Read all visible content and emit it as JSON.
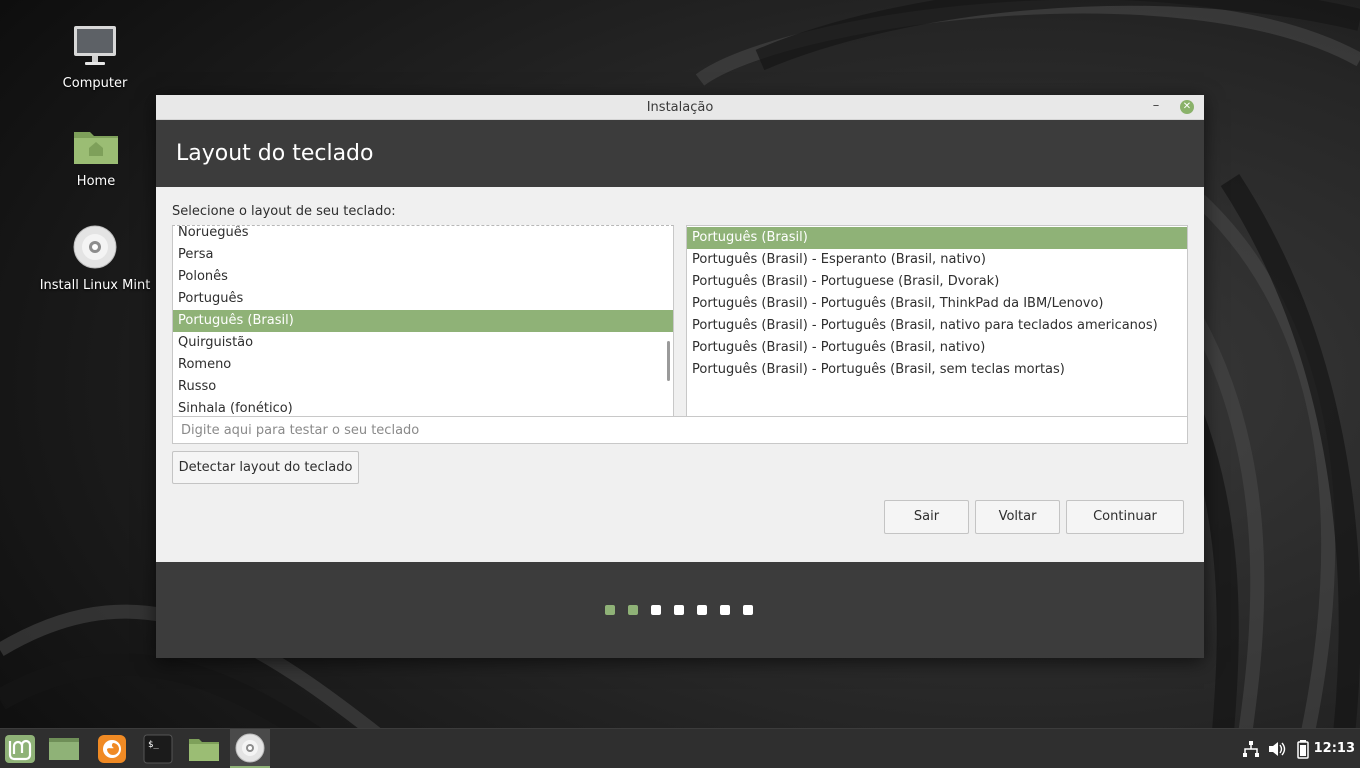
{
  "desktop": {
    "icons": [
      {
        "label": "Computer",
        "icon": "computer-icon"
      },
      {
        "label": "Home",
        "icon": "home-folder-icon"
      },
      {
        "label": "Install Linux Mint",
        "icon": "disc-icon"
      }
    ]
  },
  "window": {
    "title": "Instalação",
    "minimize_label": "–",
    "close_label": "✕",
    "header_title": "Layout do teclado",
    "prompt": "Selecione o layout de seu teclado:",
    "layouts": [
      "Norueguês",
      "Persa",
      "Polonês",
      "Português",
      "Português (Brasil)",
      "Quirguistão",
      "Romeno",
      "Russo",
      "Sinhala (fonético)"
    ],
    "selected_layout": "Português (Brasil)",
    "variants": [
      "Português (Brasil)",
      "Português (Brasil) - Esperanto (Brasil, nativo)",
      "Português (Brasil) - Portuguese (Brasil, Dvorak)",
      "Português (Brasil) - Português (Brasil, ThinkPad da IBM/Lenovo)",
      "Português (Brasil) - Português (Brasil, nativo para teclados americanos)",
      "Português (Brasil) - Português (Brasil, nativo)",
      "Português (Brasil) - Português (Brasil, sem teclas mortas)"
    ],
    "selected_variant": "Português (Brasil)",
    "test_placeholder": "Digite aqui para testar o seu teclado",
    "test_value": "",
    "detect_button": "Detectar layout do teclado",
    "quit_button": "Sair",
    "back_button": "Voltar",
    "continue_button": "Continuar",
    "progress": {
      "total_steps": 7,
      "completed_steps": 2
    }
  },
  "taskbar": {
    "items": [
      {
        "icon": "mint-menu-icon",
        "active": false
      },
      {
        "icon": "show-desktop-icon",
        "active": false
      },
      {
        "icon": "firefox-icon",
        "active": false
      },
      {
        "icon": "terminal-icon",
        "active": false
      },
      {
        "icon": "files-icon",
        "active": false
      },
      {
        "icon": "installer-disc-icon",
        "active": true
      }
    ],
    "tray": [
      "network-icon",
      "volume-icon",
      "battery-icon"
    ],
    "clock": "12:13"
  },
  "colors": {
    "accent": "#8fb277",
    "header_bg": "#3c3c3c",
    "window_bg": "#f0f0f0",
    "taskbar_bg": "#2f2f2f"
  }
}
